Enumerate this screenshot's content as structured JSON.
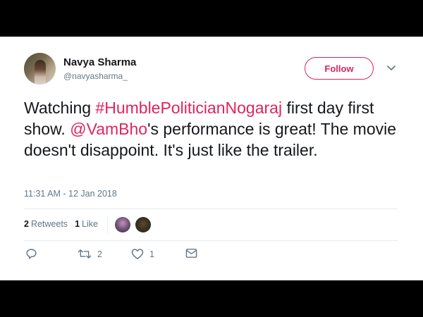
{
  "user": {
    "name": "Navya Sharma",
    "handle": "@navyasharma_"
  },
  "follow_label": "Follow",
  "tweet": {
    "p1": "Watching ",
    "hashtag": "#HumblePoliticianNogaraj",
    "p2": " first day first show. ",
    "mention": "@VamBho",
    "p3": "'s performance is great! The movie doesn't disappoint. It's just like the trailer."
  },
  "timestamp": "11:31 AM - 12 Jan 2018",
  "stats": {
    "retweets_count": "2",
    "retweets_label": "Retweets",
    "likes_count": "1",
    "likes_label": "Like"
  },
  "actions": {
    "retweet_count": "2",
    "like_count": "1"
  },
  "icons": [
    "reply-icon",
    "retweet-icon",
    "heart-icon",
    "message-icon",
    "chevron-down-icon"
  ],
  "colors": {
    "accent": "#e0245e",
    "secondary_text": "#657786",
    "text": "#14171a",
    "divider": "#e6ecf0"
  }
}
